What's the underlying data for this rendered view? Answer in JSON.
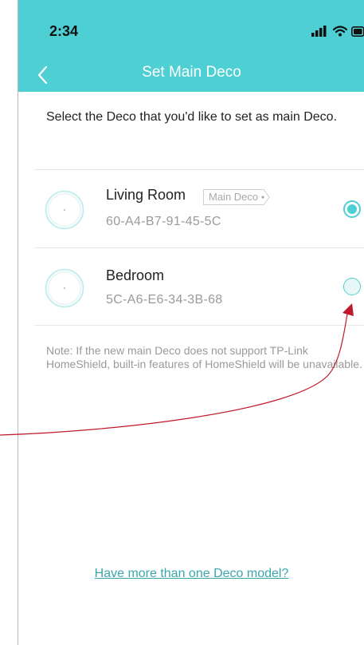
{
  "status_bar": {
    "time": "2:34",
    "icons": [
      "cellular-signal-icon",
      "wifi-icon",
      "battery-icon"
    ]
  },
  "nav": {
    "title": "Set Main Deco",
    "back_icon": "chevron-left-icon"
  },
  "intro_text": "Select the Deco that you'd like to set as main Deco.",
  "decos": [
    {
      "name": "Living Room",
      "mac": "60-A4-B7-91-45-5C",
      "badge": "Main Deco",
      "selected": true
    },
    {
      "name": "Bedroom",
      "mac": "5C-A6-E6-34-3B-68",
      "selected": false
    }
  ],
  "note": "Note: If the new main Deco does not support TP-Link HomeShield, built-in features of HomeShield will be unavailable.",
  "link_text": "Have more than one Deco model?",
  "colors": {
    "accent": "#4dcfd3",
    "annotation_arrow": "#c0182c"
  }
}
